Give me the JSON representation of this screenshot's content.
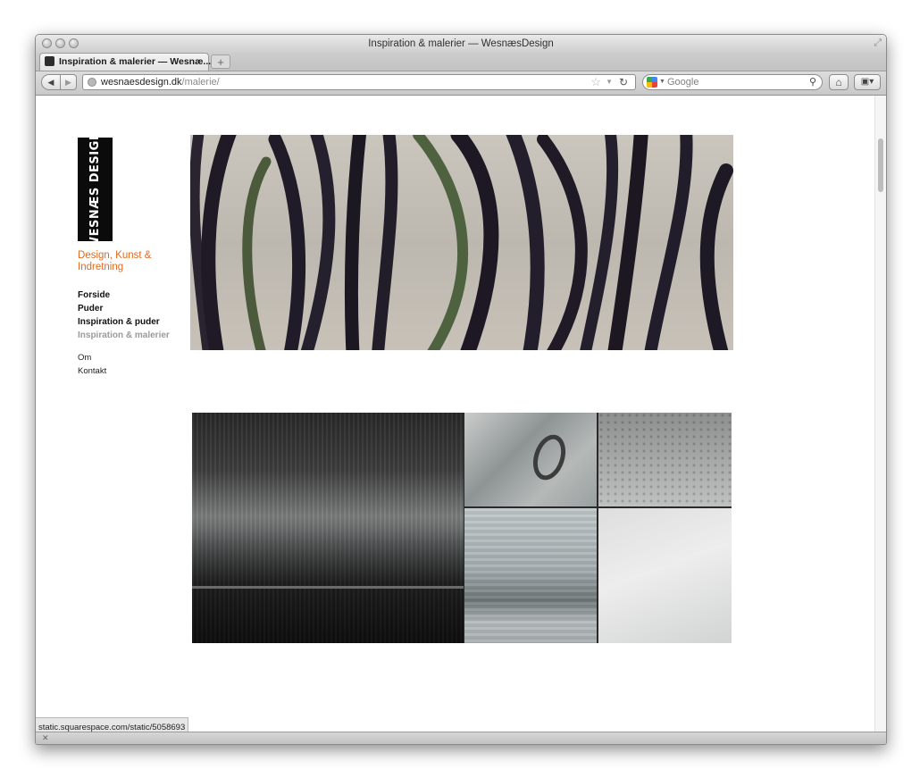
{
  "window": {
    "title": "Inspiration & malerier — WesnæsDesign"
  },
  "tab": {
    "title": "Inspiration & malerier — Wesnæ...",
    "new_tab_label": "+"
  },
  "toolbar": {
    "back_label": "◀",
    "forward_label": "▶",
    "url_domain": "wesnaesdesign.dk",
    "url_path": "/malerie/",
    "search_placeholder": "Google"
  },
  "site": {
    "logo_text": "WESNÆS DESIGN",
    "tagline": "Design, Kunst & Indretning",
    "nav_main": [
      {
        "label": "Forside"
      },
      {
        "label": "Puder"
      },
      {
        "label": "Inspiration & puder"
      },
      {
        "label": "Inspiration & malerier",
        "current": true
      }
    ],
    "nav_secondary": [
      {
        "label": "Om"
      },
      {
        "label": "Kontakt"
      }
    ]
  },
  "statusbar": {
    "text": "static.squarespace.com/static/5058693"
  },
  "icons": {
    "traffic_lights": [
      "close-icon",
      "minimize-icon",
      "zoom-icon"
    ],
    "toolbar": [
      "back-icon",
      "forward-icon",
      "site-identity-icon",
      "bookmark-star-icon",
      "history-dropdown-icon",
      "reload-icon",
      "google-icon",
      "search-icon",
      "home-icon",
      "bookmarks-icon"
    ]
  },
  "colors": {
    "accent": "#e06b22",
    "nav_current": "#9a9a9a",
    "logo_bg": "#0b0b0b"
  }
}
